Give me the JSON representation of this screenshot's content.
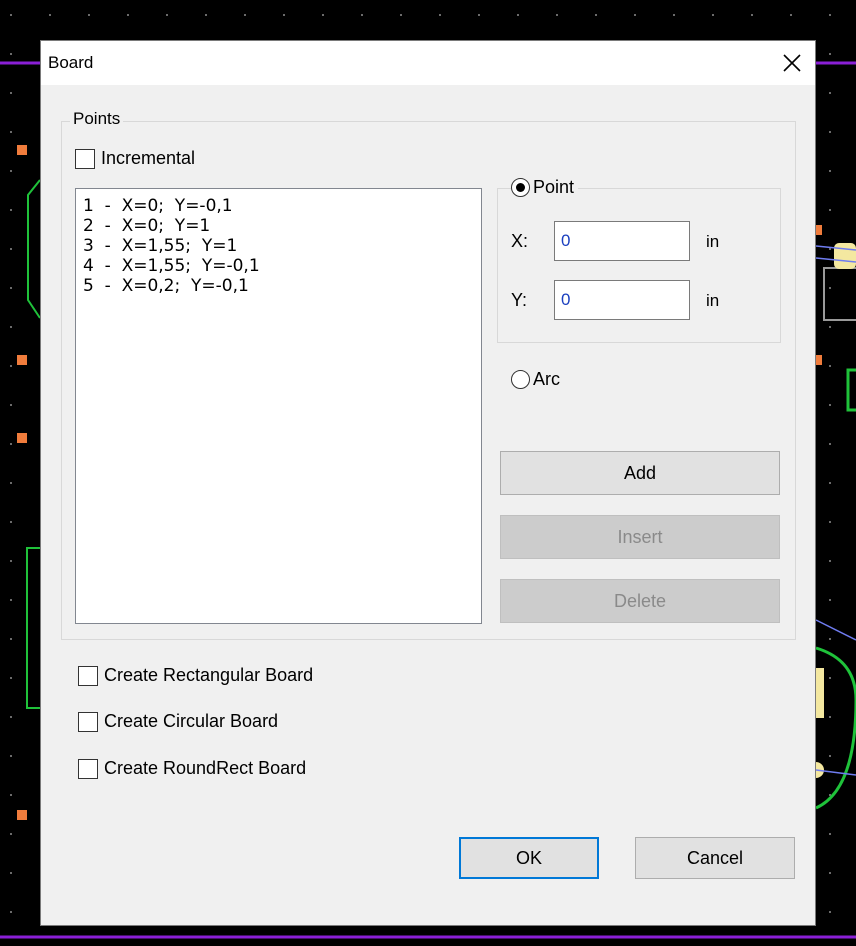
{
  "dialog": {
    "title": "Board",
    "close_glyph": "✕"
  },
  "points_group": {
    "legend": "Points",
    "incremental_label": "Incremental",
    "incremental_checked": false,
    "points": [
      "1  -  X=0;  Y=-0,1",
      "2  -  X=0;  Y=1",
      "3  -  X=1,55;  Y=1",
      "4  -  X=1,55;  Y=-0,1",
      "5  -  X=0,2;  Y=-0,1"
    ]
  },
  "point_group": {
    "legend": "Point",
    "selected": true,
    "x_label": "X:",
    "x_value": "0",
    "x_unit": "in",
    "y_label": "Y:",
    "y_value": "0",
    "y_unit": "in"
  },
  "arc": {
    "label": "Arc",
    "selected": false
  },
  "actions": {
    "add": "Add",
    "insert": "Insert",
    "delete": "Delete"
  },
  "options": {
    "rectangular": "Create Rectangular Board",
    "circular": "Create Circular Board",
    "roundrect": "Create RoundRect Board"
  },
  "footer": {
    "ok": "OK",
    "cancel": "Cancel"
  },
  "colors": {
    "pcb_background": "#000000",
    "board_outline": "#8a1fd6",
    "pad": "#f07c3c",
    "trace_green": "#1fc23a",
    "accent_focus": "#0078d7",
    "input_text": "#1a3fbf"
  }
}
